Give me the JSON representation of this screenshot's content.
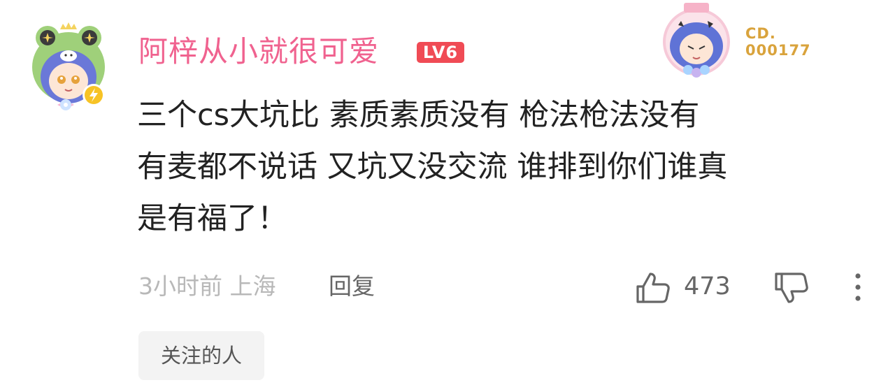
{
  "user": {
    "name": "阿梓从小就很可爱",
    "level": "LV6",
    "avatar": "frog-hood-anime-avatar",
    "name_color": "#f0628f",
    "level_color": "#f04b55"
  },
  "decoration": {
    "line1": "CD.",
    "line2": "000177",
    "color": "#d9a33c"
  },
  "comment": {
    "lines": [
      "三个cs大坑比 素质素质没有 枪法枪法没有",
      "有麦都不说话 又坑又没交流 谁排到你们谁真",
      "是有福了！"
    ]
  },
  "meta": {
    "time_location": "3小时前 上海",
    "reply_label": "回复",
    "like_count": "473"
  },
  "icons": {
    "like": "thumbs-up-icon",
    "dislike": "thumbs-down-icon",
    "more": "more-vertical-icon"
  },
  "tag": {
    "label": "关注的人"
  }
}
